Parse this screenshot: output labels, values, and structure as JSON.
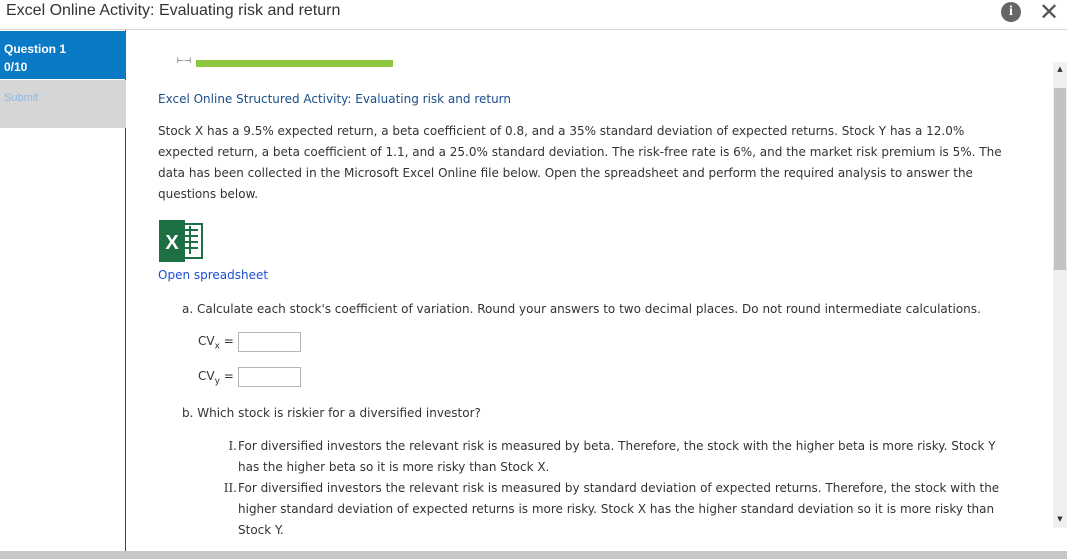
{
  "window": {
    "title": "Excel Online Activity: Evaluating risk and return"
  },
  "sidebar": {
    "question_label": "Question 1",
    "question_score": "0/10",
    "submit_label": "Submit"
  },
  "progress": {
    "fraction": 1.0
  },
  "content": {
    "heading": "Excel Online Structured Activity: Evaluating risk and return",
    "intro": "Stock X has a 9.5% expected return, a beta coefficient of 0.8, and a 35% standard deviation of expected returns. Stock Y has a 12.0% expected return, a beta coefficient of 1.1, and a 25.0% standard deviation. The risk-free rate is 6%, and the market risk premium is 5%. The data has been collected in the Microsoft Excel Online file below. Open the spreadsheet and perform the required analysis to answer the questions below.",
    "excel_icon_letter": "X",
    "open_spreadsheet": "Open spreadsheet",
    "question_a": "a. Calculate each stock's coefficient of variation. Round your answers to two decimal places. Do not round intermediate calculations.",
    "cv_x": {
      "base": "CV",
      "sub": "x",
      "eq": "=",
      "value": ""
    },
    "cv_y": {
      "base": "CV",
      "sub": "y",
      "eq": "=",
      "value": ""
    },
    "question_b": "b. Which stock is riskier for a diversified investor?",
    "options": [
      {
        "numeral": "I.",
        "text": "For diversified investors the relevant risk is measured by beta. Therefore, the stock with the higher beta is more risky. Stock Y has the higher beta so it is more risky than Stock X."
      },
      {
        "numeral": "II.",
        "text": "For diversified investors the relevant risk is measured by standard deviation of expected returns. Therefore, the stock with the higher standard deviation of expected returns is more risky. Stock X has the higher standard deviation so it is more risky than Stock Y."
      }
    ]
  },
  "icons": {
    "info": "info-icon",
    "close": "close-icon",
    "excel": "excel-icon"
  },
  "colors": {
    "question_active_bg": "#0a7ac6",
    "progress_fill": "#8dc63f",
    "link": "#1b4fd8",
    "excel_green": "#1d7044"
  }
}
